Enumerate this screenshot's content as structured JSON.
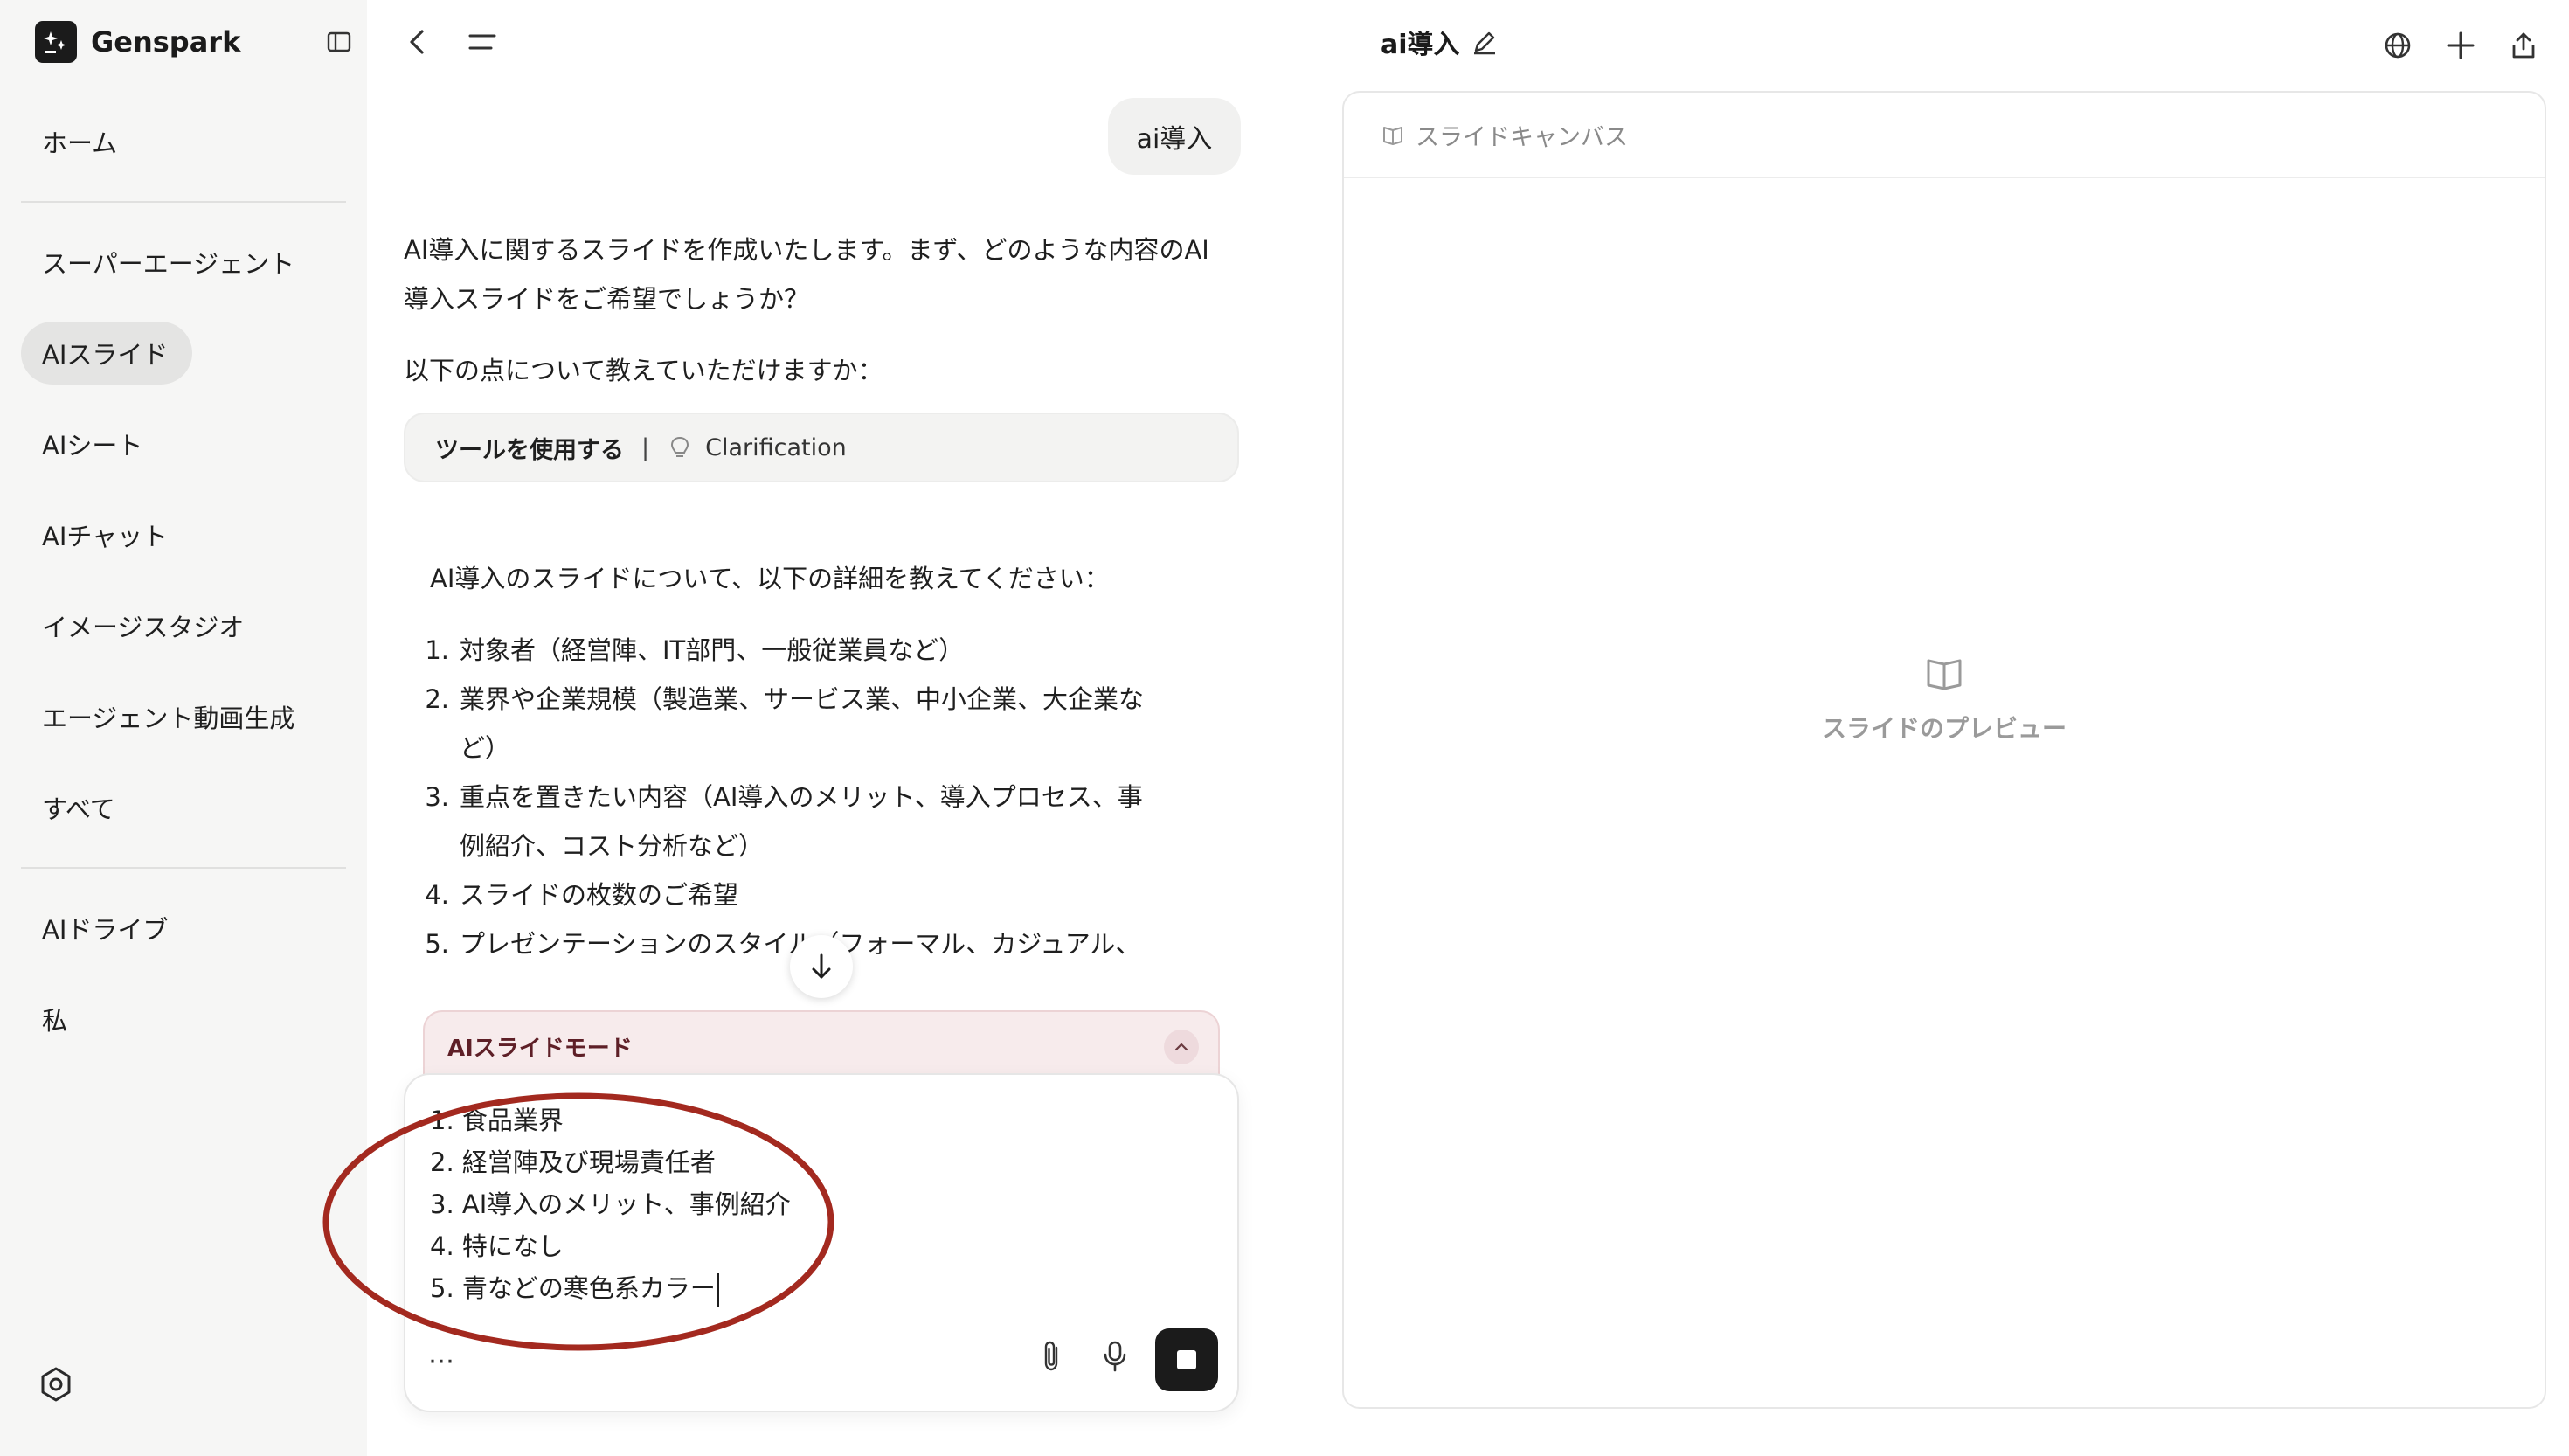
{
  "app": {
    "name": "Genspark"
  },
  "sidebar": {
    "items": [
      {
        "label": "ホーム"
      },
      {
        "label": "スーパーエージェント"
      },
      {
        "label": "AIスライド",
        "active": true
      },
      {
        "label": "AIシート"
      },
      {
        "label": "AIチャット"
      },
      {
        "label": "イメージスタジオ"
      },
      {
        "label": "エージェント動画生成"
      },
      {
        "label": "すべて"
      },
      {
        "label": "AIドライブ"
      },
      {
        "label": "私"
      }
    ]
  },
  "header": {
    "title": "ai導入"
  },
  "chat": {
    "user_message": "ai導入",
    "assistant_intro_line1": "AI導入に関するスライドを作成いたします。まず、どのような内容のAI",
    "assistant_intro_line2": "導入スライドをご希望でしょうか？",
    "assistant_ask": "以下の点について教えていただけますか：",
    "tool_use": {
      "label": "ツールを使用する",
      "separator": "|",
      "tool_name": "Clarification"
    },
    "details_heading": "AI導入のスライドについて、以下の詳細を教えてください：",
    "list": [
      {
        "num": "1.",
        "lines": [
          "対象者（経営陣、IT部門、一般従業員など）"
        ]
      },
      {
        "num": "2.",
        "lines": [
          "業界や企業規模（製造業、サービス業、中小企業、大企業な",
          "ど）"
        ]
      },
      {
        "num": "3.",
        "lines": [
          "重点を置きたい内容（AI導入のメリット、導入プロセス、事",
          "例紹介、コスト分析など）"
        ]
      },
      {
        "num": "4.",
        "lines": [
          "スライドの枚数のご希望"
        ]
      },
      {
        "num": "5.",
        "lines": [
          "プレゼンテーションのスタイル（フォーマル、カジュアル、"
        ]
      }
    ]
  },
  "composer": {
    "mode_label": "AIスライドモード",
    "input_lines": [
      "1. 食品業界",
      "2. 経営陣及び現場責任者",
      "3. AI導入のメリット、事例紹介",
      "4. 特になし",
      "5. 青などの寒色系カラー"
    ],
    "more_label": "⋯"
  },
  "canvas": {
    "header_label": "スライドキャンバス",
    "preview_label": "スライドのプレビュー"
  },
  "colors": {
    "accent_dark": "#1b1b1b",
    "mode_bar_bg": "#f7ebec",
    "mode_label": "#5e1f27",
    "annotation_ellipse": "#a3291f"
  },
  "icons": {
    "brand": "genspark-logo-icon",
    "sidebar_toggle": "sidebar-toggle-icon",
    "back": "chevron-left-icon",
    "menu": "menu-lines-icon",
    "edit": "pencil-icon",
    "language": "globe-icon",
    "new": "plus-icon",
    "share": "share-icon",
    "settings": "settings-hexagon-icon",
    "tool": "lightbulb-icon",
    "scroll": "arrow-down-icon",
    "collapse": "chevron-up-icon",
    "attach": "paperclip-icon",
    "mic": "microphone-icon",
    "stop": "stop-icon",
    "canvas": "book-open-icon"
  }
}
